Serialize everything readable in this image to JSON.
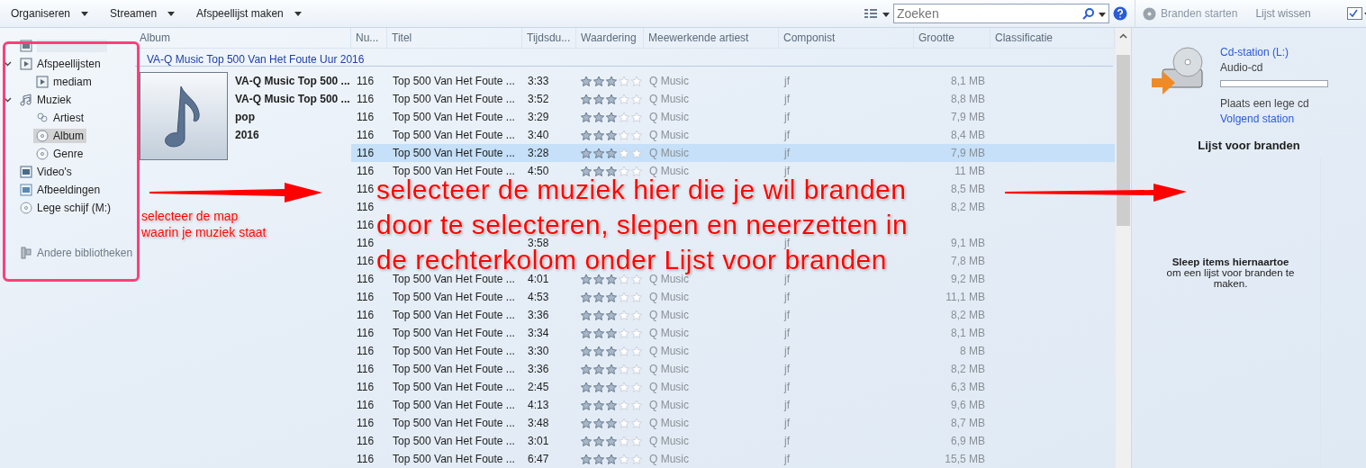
{
  "toolbar": {
    "menus": [
      {
        "label": "Organiseren"
      },
      {
        "label": "Streamen"
      },
      {
        "label": "Afspeellijst maken"
      }
    ],
    "search": {
      "placeholder": "Zoeken"
    }
  },
  "burn_toolbar": {
    "start": {
      "label": "Branden starten",
      "disabled": true
    },
    "clear": {
      "label": "Lijst wissen"
    }
  },
  "navigation": [
    {
      "kind": "library",
      "selected": false
    },
    {
      "label": "Afspeellijsten",
      "kind": "playlist",
      "expanded": true,
      "selected": false,
      "children": [
        {
          "label": "mediam",
          "kind": "playlist",
          "selected": false
        }
      ]
    },
    {
      "label": "Muziek",
      "kind": "music",
      "expanded": true,
      "selected": false,
      "children": [
        {
          "label": "Artiest",
          "kind": "artist",
          "selected": false
        },
        {
          "label": "Album",
          "kind": "album",
          "selected": true
        },
        {
          "label": "Genre",
          "kind": "genre",
          "selected": false
        }
      ]
    },
    {
      "label": "Video's",
      "kind": "video",
      "selected": false
    },
    {
      "label": "Afbeeldingen",
      "kind": "picture",
      "selected": false
    },
    {
      "label": "Lege schijf (M:)",
      "kind": "disc",
      "selected": false
    }
  ],
  "other_libraries": {
    "label": "Andere bibliotheken"
  },
  "table": {
    "columns": [
      "Album",
      "Nu...",
      "Titel",
      "Tijdsdu...",
      "Waardering",
      "Meewerkende artiest",
      "Componist",
      "Grootte",
      "Classificatie"
    ],
    "group": "VA-Q Music Top 500 Van Het Foute Uur 2016",
    "album_info": [
      "VA-Q Music Top 500 ...",
      "VA-Q Music Top 500 ...",
      "pop",
      "2016"
    ],
    "rows": [
      {
        "number": "116",
        "title": "Top 500 Van Het Foute ...",
        "duration": "3:33",
        "stars": 3,
        "artist": "Q Music",
        "composer": "jf",
        "size": "8,1 MB",
        "selected": false
      },
      {
        "number": "116",
        "title": "Top 500 Van Het Foute ...",
        "duration": "3:52",
        "stars": 3,
        "artist": "Q Music",
        "composer": "jf",
        "size": "8,8 MB",
        "selected": false
      },
      {
        "number": "116",
        "title": "Top 500 Van Het Foute ...",
        "duration": "3:29",
        "stars": 3,
        "artist": "Q Music",
        "composer": "jf",
        "size": "7,9 MB",
        "selected": false
      },
      {
        "number": "116",
        "title": "Top 500 Van Het Foute ...",
        "duration": "3:40",
        "stars": 3,
        "artist": "Q Music",
        "composer": "jf",
        "size": "8,4 MB",
        "selected": false
      },
      {
        "number": "116",
        "title": "Top 500 Van Het Foute ...",
        "duration": "3:28",
        "stars": 3,
        "artist": "Q Music",
        "composer": "jf",
        "size": "7,9 MB",
        "selected": true
      },
      {
        "number": "116",
        "title": "Top 500 Van Het Foute ...",
        "duration": "4:50",
        "stars": 3,
        "artist": "Q Music",
        "composer": "jf",
        "size": "11 MB",
        "selected": false
      },
      {
        "number": "116",
        "size": "8,5 MB",
        "selected": false
      },
      {
        "number": "116",
        "size": "8,2 MB",
        "selected": false
      },
      {
        "number": "116",
        "selected": false
      },
      {
        "number": "116",
        "duration": "3:58",
        "composer": "jf",
        "size": "9,1 MB",
        "selected": false
      },
      {
        "number": "116",
        "size": "7,8 MB",
        "selected": false
      },
      {
        "number": "116",
        "title": "Top 500 Van Het Foute ...",
        "duration": "4:01",
        "stars": 3,
        "artist": "Q Music",
        "composer": "jf",
        "size": "9,2 MB",
        "selected": false
      },
      {
        "number": "116",
        "title": "Top 500 Van Het Foute ...",
        "duration": "4:53",
        "stars": 3,
        "artist": "Q Music",
        "composer": "jf",
        "size": "11,1 MB",
        "selected": false
      },
      {
        "number": "116",
        "title": "Top 500 Van Het Foute ...",
        "duration": "3:36",
        "stars": 3,
        "artist": "Q Music",
        "composer": "jf",
        "size": "8,2 MB",
        "selected": false
      },
      {
        "number": "116",
        "title": "Top 500 Van Het Foute ...",
        "duration": "3:34",
        "stars": 3,
        "artist": "Q Music",
        "composer": "jf",
        "size": "8,1 MB",
        "selected": false
      },
      {
        "number": "116",
        "title": "Top 500 Van Het Foute ...",
        "duration": "3:30",
        "stars": 3,
        "artist": "Q Music",
        "composer": "jf",
        "size": "8 MB",
        "selected": false
      },
      {
        "number": "116",
        "title": "Top 500 Van Het Foute ...",
        "duration": "3:36",
        "stars": 3,
        "artist": "Q Music",
        "composer": "jf",
        "size": "8,2 MB",
        "selected": false
      },
      {
        "number": "116",
        "title": "Top 500 Van Het Foute ...",
        "duration": "2:45",
        "stars": 3,
        "artist": "Q Music",
        "composer": "jf",
        "size": "6,3 MB",
        "selected": false
      },
      {
        "number": "116",
        "title": "Top 500 Van Het Foute ...",
        "duration": "4:13",
        "stars": 3,
        "artist": "Q Music",
        "composer": "jf",
        "size": "9,6 MB",
        "selected": false
      },
      {
        "number": "116",
        "title": "Top 500 Van Het Foute ...",
        "duration": "3:48",
        "stars": 3,
        "artist": "Q Music",
        "composer": "jf",
        "size": "8,7 MB",
        "selected": false
      },
      {
        "number": "116",
        "title": "Top 500 Van Het Foute ...",
        "duration": "3:01",
        "stars": 3,
        "artist": "Q Music",
        "composer": "jf",
        "size": "6,9 MB",
        "selected": false
      },
      {
        "number": "116",
        "title": "Top 500 Van Het Foute ...",
        "duration": "6:47",
        "stars": 3,
        "artist": "Q Music",
        "composer": "jf",
        "size": "15,5 MB",
        "selected": false
      }
    ]
  },
  "burn_panel": {
    "drive": "Cd-station (L:)",
    "media": "Audio-cd",
    "level": 0,
    "status": "Plaats een lege cd",
    "next": "Volgend station",
    "list_title": "Lijst voor branden",
    "hint_title": "Sleep items hiernaartoe",
    "hint": "om een lijst voor branden te maken."
  },
  "annotations": {
    "left": [
      "selecteer de map",
      "waarin je muziek staat"
    ],
    "center": [
      "selecteer de muziek hier die je wil branden",
      "door te selecteren, slepen en neerzetten in",
      "de rechterkolom onder Lijst voor branden"
    ]
  }
}
